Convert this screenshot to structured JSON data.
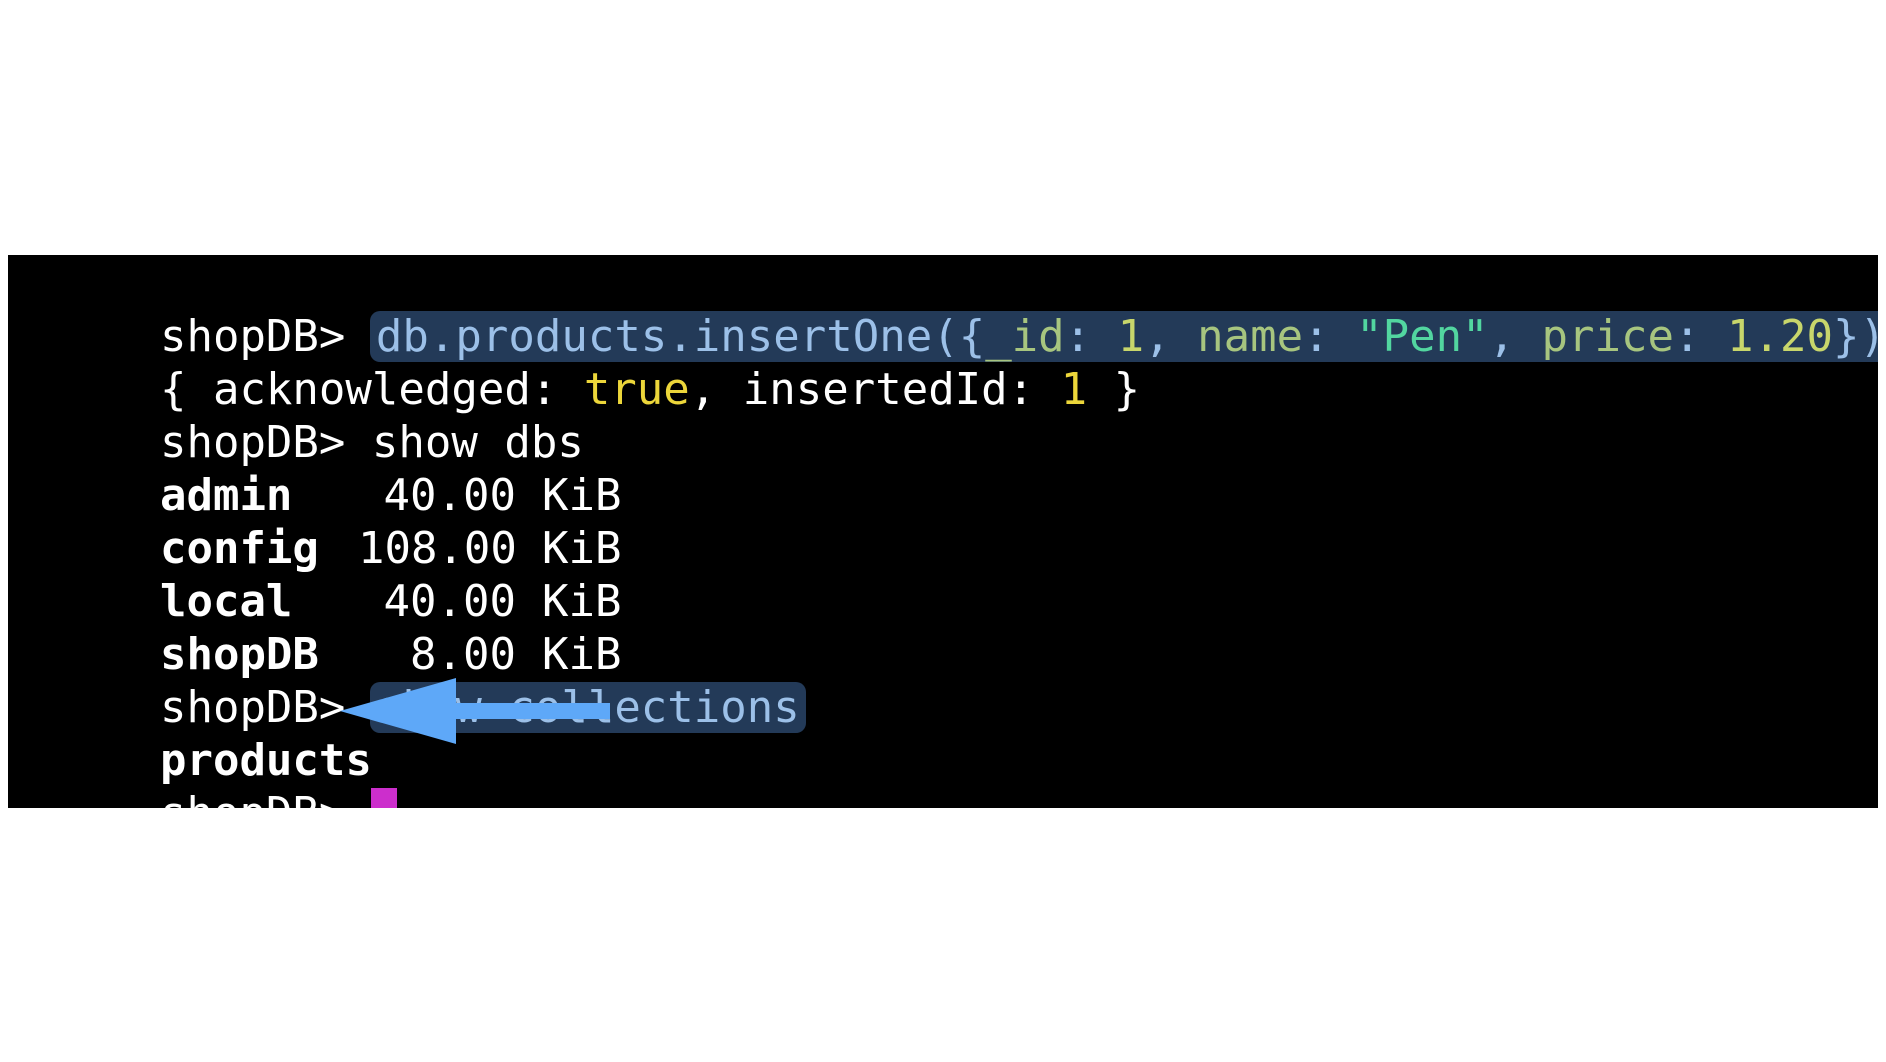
{
  "terminal": {
    "prompt": "shopDB>",
    "insert_command": {
      "fn": "db.products.insertOne",
      "open": "({",
      "k_id": "_id",
      "colon1": ": ",
      "v_id": "1",
      "sep1": ", ",
      "k_name": "name",
      "colon2": ": ",
      "v_name": "\"Pen\"",
      "sep2": ", ",
      "k_price": "price",
      "colon3": ": ",
      "v_price": "1.20",
      "close": "})"
    },
    "insert_result": {
      "open": "{ acknowledged: ",
      "ack_value": "true",
      "mid": ", insertedId: ",
      "id_value": "1",
      "close": " }"
    },
    "show_dbs_command": "show dbs",
    "databases": [
      {
        "name": "admin",
        "size": "40.00",
        "unit": "KiB"
      },
      {
        "name": "config",
        "size": "108.00",
        "unit": "KiB"
      },
      {
        "name": "local",
        "size": "40.00",
        "unit": "KiB"
      },
      {
        "name": "shopDB",
        "size": "8.00",
        "unit": "KiB"
      }
    ],
    "show_collections_command": "show collections",
    "collections": [
      "products"
    ],
    "cursor_color": "#cc2ecc",
    "highlight_color": "#233a58"
  },
  "annotation": {
    "icon": "arrow-left-icon",
    "color": "#5ea8f8"
  }
}
